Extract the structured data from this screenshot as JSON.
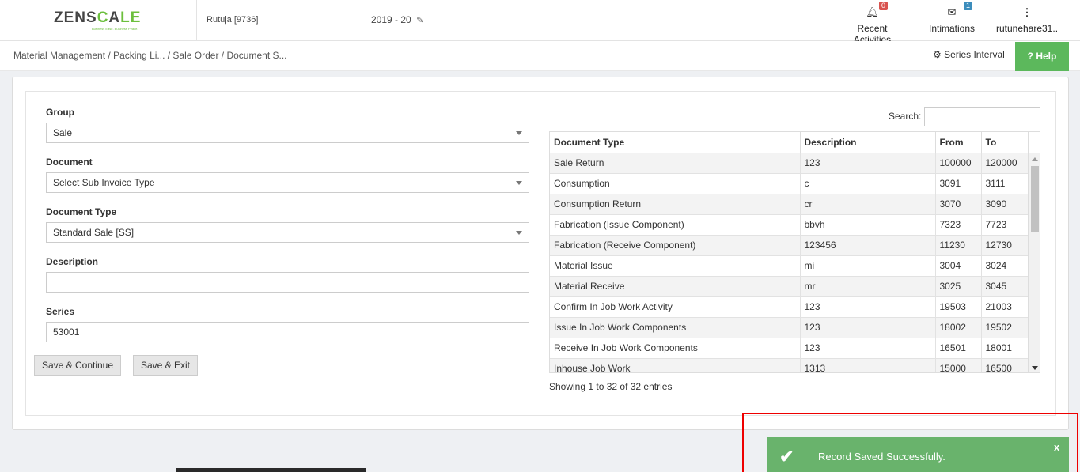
{
  "header": {
    "logo_text_a": "ZENS",
    "logo_text_b": "C",
    "logo_text_c": "A",
    "logo_text_d": "LE",
    "logo_tagline": "Business Ease. Business Peace.",
    "user_id": "Rutuja [9736]",
    "fiscal_year": "2019 - 20",
    "recent_activities": {
      "label": "Recent Activities",
      "count": "0",
      "icon": "bell-icon"
    },
    "intimations": {
      "label": "Intimations",
      "count": "1",
      "icon": "envelope-icon"
    },
    "username": "rutunehare31.."
  },
  "breadcrumb": {
    "text": "Material Management   / Packing Li... / Sale Order / Document S..."
  },
  "toolbar": {
    "series_interval": "Series Interval",
    "help": "Help"
  },
  "form": {
    "group_label": "Group",
    "group_value": "Sale",
    "document_label": "Document",
    "document_value": "Select Sub Invoice Type",
    "doctype_label": "Document Type",
    "doctype_value": "Standard Sale [SS]",
    "description_label": "Description",
    "description_value": "",
    "series_label": "Series",
    "series_value": "53001",
    "save_continue": "Save & Continue",
    "save_exit": "Save & Exit"
  },
  "table": {
    "search_label": "Search:",
    "columns": [
      "Document Type",
      "Description",
      "From",
      "To"
    ],
    "rows": [
      [
        "Sale Return",
        "123",
        "100000",
        "120000"
      ],
      [
        "Consumption",
        "c",
        "3091",
        "3111"
      ],
      [
        "Consumption Return",
        "cr",
        "3070",
        "3090"
      ],
      [
        "Fabrication (Issue Component)",
        "bbvh",
        "7323",
        "7723"
      ],
      [
        "Fabrication (Receive Component)",
        "123456",
        "11230",
        "12730"
      ],
      [
        "Material Issue",
        "mi",
        "3004",
        "3024"
      ],
      [
        "Material Receive",
        "mr",
        "3025",
        "3045"
      ],
      [
        "Confirm In Job Work Activity",
        "123",
        "19503",
        "21003"
      ],
      [
        "Issue In Job Work Components",
        "123",
        "18002",
        "19502"
      ],
      [
        "Receive In Job Work Components",
        "123",
        "16501",
        "18001"
      ],
      [
        "Inhouse Job Work",
        "1313",
        "15000",
        "16500"
      ]
    ],
    "showing": "Showing 1 to 32 of 32 entries"
  },
  "toast": {
    "message": "Record Saved Successfully.",
    "close": "x"
  }
}
